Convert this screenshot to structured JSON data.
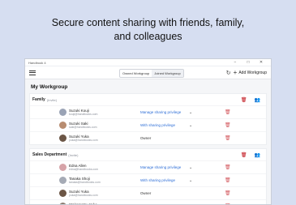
{
  "headline": [
    "Secure content sharing with friends, family,",
    "and colleagues"
  ],
  "window": {
    "app_title": "Handbook 4",
    "controls": {
      "minimize": "−",
      "maximize": "□",
      "close": "✕"
    }
  },
  "toolbar": {
    "tabs": [
      {
        "label": "Owned Workgroup",
        "active": false
      },
      {
        "label": "Joined Workgroup",
        "active": true
      }
    ],
    "refresh_icon": "↻",
    "add_label": "Add Workgroup",
    "add_icon": "+"
  },
  "page_title": "My Workgroup",
  "groups": [
    {
      "name": "Family",
      "count": "(Invite)",
      "members": [
        {
          "name": "Suzuki Kouji",
          "email": "kouji@handbooks.com",
          "permission": "Manage sharing privilege",
          "dropdown": true,
          "avatar_color": "#9aa3b5"
        },
        {
          "name": "Suzuki Saki",
          "email": "saki@handbooks.com",
          "permission": "With sharing privilege",
          "dropdown": true,
          "avatar_color": "#b88c70"
        },
        {
          "name": "Suzuki Yuka",
          "email": "yuka@handbooks.com",
          "permission": "Owner",
          "dropdown": false,
          "avatar_color": "#6b5545"
        }
      ]
    },
    {
      "name": "Sales Department",
      "count": "(Invite)",
      "members": [
        {
          "name": "Edna Allen",
          "email": "edna@handbooks.com",
          "permission": "Manage sharing privilege",
          "dropdown": true,
          "avatar_color": "#d6a3a8"
        },
        {
          "name": "Tanaka Shoji",
          "email": "tanaka@handbooks.com",
          "permission": "With sharing privilege",
          "dropdown": true,
          "avatar_color": "#a5aab5"
        },
        {
          "name": "Suzuki Yuka",
          "email": "yuka@handbooks.com",
          "permission": "Owner",
          "dropdown": false,
          "avatar_color": "#6b5545"
        },
        {
          "name": "Wakamatsu Yuko",
          "email": "wakamatsu@handbooks.com",
          "permission": "With sharing privilege",
          "dropdown": true,
          "avatar_color": "#8a7c70"
        }
      ]
    }
  ],
  "icons": {
    "trash": "🗑",
    "share": "👥",
    "chevron": "⌄"
  }
}
